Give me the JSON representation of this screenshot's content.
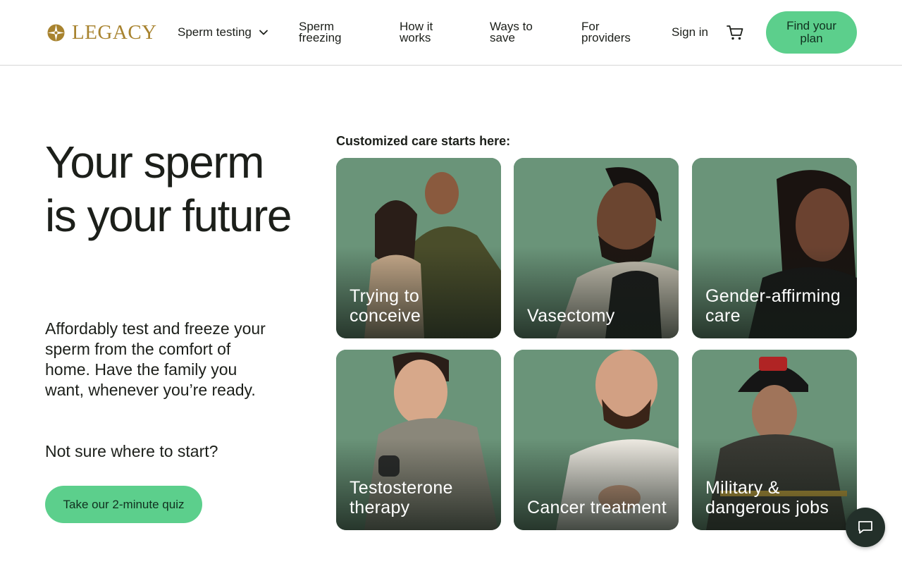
{
  "header": {
    "logo_text": "LEGACY",
    "nav": {
      "sperm_testing": "Sperm testing",
      "sperm_freezing": "Sperm freezing",
      "how_it_works": "How it works",
      "ways_to_save": "Ways to save",
      "for_providers": "For providers"
    },
    "sign_in": "Sign in",
    "cta": "Find your plan"
  },
  "hero": {
    "title": "Your sperm is your future",
    "description": "Affordably test and freeze your sperm from the comfort of home. Have the family you want, whenever you’re ready.",
    "prompt": "Not sure where to start?",
    "quiz_button": "Take our 2-minute quiz"
  },
  "care": {
    "heading": "Customized care starts here:",
    "cards": [
      {
        "label": "Trying to conceive"
      },
      {
        "label": "Vasectomy"
      },
      {
        "label": "Gender-affirming care"
      },
      {
        "label": "Testosterone therapy"
      },
      {
        "label": "Cancer treatment"
      },
      {
        "label": "Military & dangerous jobs"
      }
    ]
  },
  "colors": {
    "accent_green": "#5ccf8c",
    "card_bg": "#6a9479",
    "logo_gold": "#a8832f",
    "chat_bg": "#23302a"
  },
  "icons": [
    "logo-mark-icon",
    "chevron-down-icon",
    "cart-icon",
    "chat-icon"
  ]
}
